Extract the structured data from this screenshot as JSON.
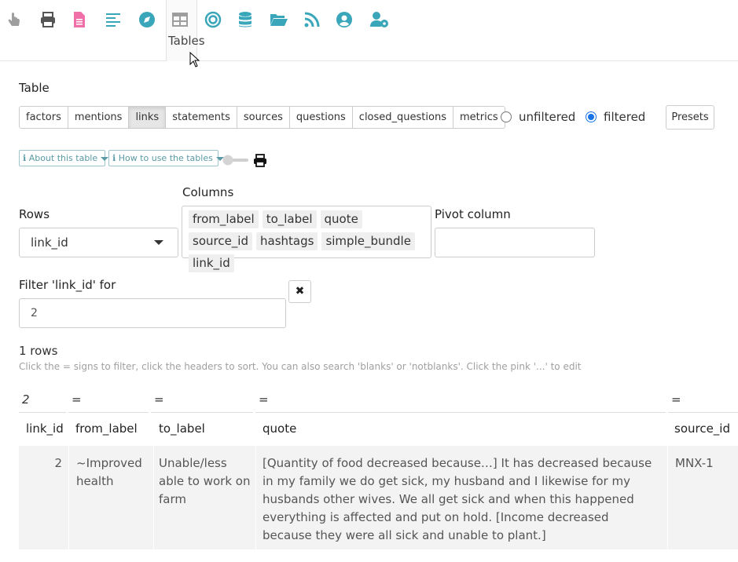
{
  "toolbar": {
    "icons": [
      {
        "name": "touch-icon",
        "color": "#9e9e9e"
      },
      {
        "name": "print-icon",
        "color": "#555555"
      },
      {
        "name": "document-icon",
        "color": "#f06fa8"
      },
      {
        "name": "align-left-icon",
        "color": "#3aa6b9"
      },
      {
        "name": "compass-icon",
        "color": "#3aa6b9"
      },
      {
        "name": "table-icon",
        "color": "#9e9e9e"
      },
      {
        "name": "target-icon",
        "color": "#3aa6b9"
      },
      {
        "name": "database-icon",
        "color": "#3aa6b9"
      },
      {
        "name": "folder-open-icon",
        "color": "#3aa6b9"
      },
      {
        "name": "rss-icon",
        "color": "#3aa6b9"
      },
      {
        "name": "user-circle-icon",
        "color": "#3aa6b9"
      },
      {
        "name": "user-cog-icon",
        "color": "#3aa6b9"
      }
    ],
    "active_tooltip": "Tables"
  },
  "table_section": {
    "label": "Table",
    "tabs": [
      "factors",
      "mentions",
      "links",
      "statements",
      "sources",
      "questions",
      "closed_questions",
      "metrics"
    ],
    "active_tab": "links",
    "radio": {
      "unfiltered": "unfiltered",
      "filtered": "filtered",
      "selected": "filtered"
    },
    "presets_label": "Presets"
  },
  "helpers": {
    "about": "About this table",
    "how_to": "How to use the tables"
  },
  "rows": {
    "label": "Rows",
    "value": "link_id"
  },
  "columns": {
    "label": "Columns",
    "chips": [
      "from_label",
      "to_label",
      "quote",
      "source_id",
      "hashtags",
      "simple_bundle",
      "link_id"
    ]
  },
  "pivot": {
    "label": "Pivot column",
    "value": ""
  },
  "filter": {
    "label": "Filter 'link_id' for",
    "value": "2",
    "clear_symbol": "✖"
  },
  "result": {
    "count": "1 rows",
    "hint": "Click the = signs to filter, click the headers to sort. You can also search 'blanks' or 'notblanks'. Click the pink '...' to edit"
  },
  "grid": {
    "filter_row": [
      "2",
      "=",
      "=",
      "=",
      "="
    ],
    "headers": [
      "link_id",
      "from_label",
      "to_label",
      "quote",
      "source_id"
    ],
    "rows": [
      {
        "link_id": "2",
        "from_label": "~Improved health",
        "to_label": "Unable/less able to work on farm",
        "quote": "[Quantity of food decreased because…] It has decreased because in my family we do get sick, my husband and I likewise for my husbands other wives. We all get sick and when this happened everything is affected and put on hold. [Income decreased because they were all sick and unable to plant.]",
        "source_id": "MNX-1"
      }
    ]
  }
}
